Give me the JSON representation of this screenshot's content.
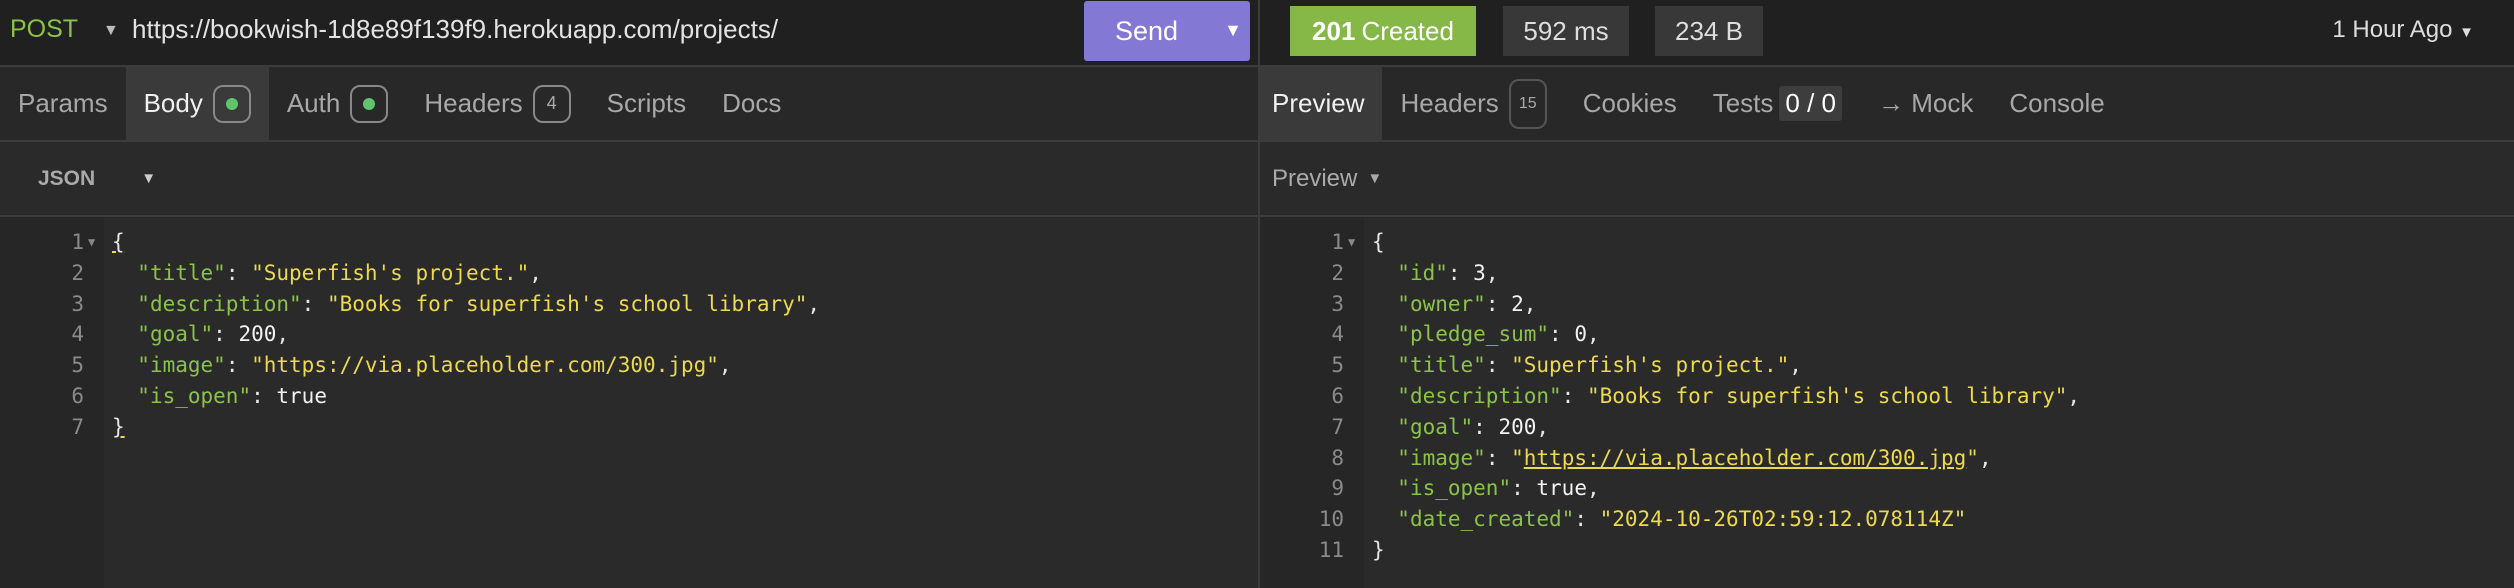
{
  "request": {
    "method": "POST",
    "url": "https://bookwish-1d8e89f139f9.herokuapp.com/projects/",
    "send_label": "Send",
    "tabs": [
      {
        "label": "Params"
      },
      {
        "label": "Body"
      },
      {
        "label": "Auth"
      },
      {
        "label": "Headers",
        "count": "4"
      },
      {
        "label": "Scripts"
      },
      {
        "label": "Docs"
      }
    ],
    "body_format": "JSON",
    "lines": [
      [
        [
          "p",
          "{"
        ]
      ],
      [
        [
          "p",
          "  "
        ],
        [
          "k",
          "\"title\""
        ],
        [
          "p",
          ": "
        ],
        [
          "s",
          "\"Superfish's project.\""
        ],
        [
          "p",
          ","
        ]
      ],
      [
        [
          "p",
          "  "
        ],
        [
          "k",
          "\"description\""
        ],
        [
          "p",
          ": "
        ],
        [
          "s",
          "\"Books for superfish's school library\""
        ],
        [
          "p",
          ","
        ]
      ],
      [
        [
          "p",
          "  "
        ],
        [
          "k",
          "\"goal\""
        ],
        [
          "p",
          ": "
        ],
        [
          "n",
          "200"
        ],
        [
          "p",
          ","
        ]
      ],
      [
        [
          "p",
          "  "
        ],
        [
          "k",
          "\"image\""
        ],
        [
          "p",
          ": "
        ],
        [
          "s",
          "\"https://via.placeholder.com/300.jpg\""
        ],
        [
          "p",
          ","
        ]
      ],
      [
        [
          "p",
          "  "
        ],
        [
          "k",
          "\"is_open\""
        ],
        [
          "p",
          ": "
        ],
        [
          "n",
          "true"
        ]
      ],
      [
        [
          "p",
          "}"
        ]
      ]
    ]
  },
  "response": {
    "status_code": "201",
    "status_text": "Created",
    "time": "592 ms",
    "size": "234 B",
    "history": "1 Hour Ago",
    "tabs": [
      {
        "label": "Preview"
      },
      {
        "label": "Headers",
        "count": "15"
      },
      {
        "label": "Cookies"
      },
      {
        "label": "Tests",
        "count": "0 / 0"
      },
      {
        "label": "→ Mock"
      },
      {
        "label": "Console"
      }
    ],
    "preview_mode": "Preview",
    "lines": [
      [
        [
          "p",
          "{"
        ]
      ],
      [
        [
          "p",
          "  "
        ],
        [
          "k",
          "\"id\""
        ],
        [
          "p",
          ": "
        ],
        [
          "n",
          "3"
        ],
        [
          "p",
          ","
        ]
      ],
      [
        [
          "p",
          "  "
        ],
        [
          "k",
          "\"owner\""
        ],
        [
          "p",
          ": "
        ],
        [
          "n",
          "2"
        ],
        [
          "p",
          ","
        ]
      ],
      [
        [
          "p",
          "  "
        ],
        [
          "k",
          "\"pledge_sum\""
        ],
        [
          "p",
          ": "
        ],
        [
          "n",
          "0"
        ],
        [
          "p",
          ","
        ]
      ],
      [
        [
          "p",
          "  "
        ],
        [
          "k",
          "\"title\""
        ],
        [
          "p",
          ": "
        ],
        [
          "s",
          "\"Superfish's project.\""
        ],
        [
          "p",
          ","
        ]
      ],
      [
        [
          "p",
          "  "
        ],
        [
          "k",
          "\"description\""
        ],
        [
          "p",
          ": "
        ],
        [
          "s",
          "\"Books for superfish's school library\""
        ],
        [
          "p",
          ","
        ]
      ],
      [
        [
          "p",
          "  "
        ],
        [
          "k",
          "\"goal\""
        ],
        [
          "p",
          ": "
        ],
        [
          "n",
          "200"
        ],
        [
          "p",
          ","
        ]
      ],
      [
        [
          "p",
          "  "
        ],
        [
          "k",
          "\"image\""
        ],
        [
          "p",
          ": "
        ],
        [
          "s",
          "\""
        ],
        [
          "u",
          "https://via.placeholder.com/300.jpg"
        ],
        [
          "s",
          "\""
        ],
        [
          "p",
          ","
        ]
      ],
      [
        [
          "p",
          "  "
        ],
        [
          "k",
          "\"is_open\""
        ],
        [
          "p",
          ": "
        ],
        [
          "n",
          "true"
        ],
        [
          "p",
          ","
        ]
      ],
      [
        [
          "p",
          "  "
        ],
        [
          "k",
          "\"date_created\""
        ],
        [
          "p",
          ": "
        ],
        [
          "s",
          "\"2024-10-26T02:59:12.078114Z\""
        ]
      ],
      [
        [
          "p",
          "}"
        ]
      ]
    ]
  },
  "colors": {
    "send": "#8378d3",
    "status_ok": "#86b848",
    "json_key": "#8bc34a",
    "json_string": "#ecd94e"
  }
}
